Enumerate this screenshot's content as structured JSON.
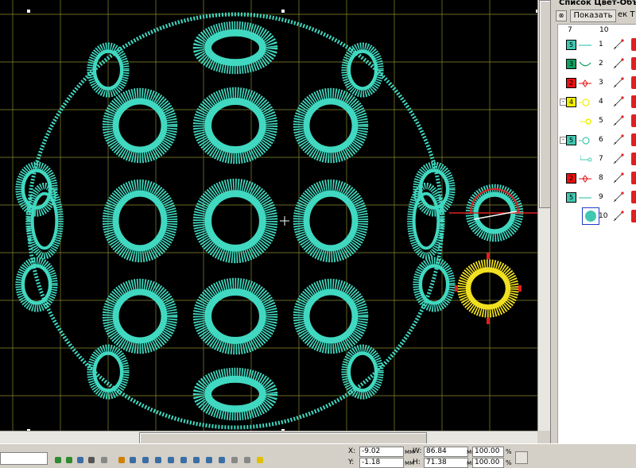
{
  "panel": {
    "title": "Список Цвет-Объект",
    "show_button": "Показать",
    "right_text": "ек Т",
    "col_headers": [
      "7",
      "10"
    ],
    "rows": [
      {
        "num": "1",
        "swatch_label": "5",
        "color": "#40c8b0",
        "type": "line"
      },
      {
        "num": "2",
        "swatch_label": "3",
        "color": "#10a060",
        "type": "curve"
      },
      {
        "num": "3",
        "swatch_label": "2",
        "color": "#e81010",
        "type": "diamond"
      },
      {
        "num": "4",
        "swatch_label": "4",
        "color": "#f0f000",
        "type": "circle",
        "expand": "-"
      },
      {
        "num": "5",
        "swatch_label": "",
        "color": "#f0f000",
        "type": "dot"
      },
      {
        "num": "6",
        "swatch_label": "5",
        "color": "#40c8b0",
        "type": "circle",
        "expand": "-"
      },
      {
        "num": "7",
        "swatch_label": "",
        "color": "#40c8b0",
        "type": "corner"
      },
      {
        "num": "8",
        "swatch_label": "2",
        "color": "#e81010",
        "type": "diamond"
      },
      {
        "num": "9",
        "swatch_label": "5",
        "color": "#40c8b0",
        "type": "line"
      },
      {
        "num": "10",
        "swatch_label": "",
        "color": "#40c8b0",
        "type": "thumbnail"
      }
    ]
  },
  "status": {
    "x_label": "X:",
    "x_value": "-9.02",
    "x_unit": "мм",
    "y_label": "Y:",
    "y_value": "-1.18",
    "y_unit": "мм",
    "w_label": "W:",
    "w_value": "86.84",
    "w_unit": "мм",
    "h_label": "H:",
    "h_value": "71.38",
    "h_unit": "мм",
    "sx_value": "100.00",
    "sx_unit": "%",
    "sy_value": "100.00",
    "sy_unit": "%"
  },
  "colors": {
    "stitch": "#40d8c0",
    "yellow": "#f0e020",
    "red": "#e02020",
    "grid": "#8a8a30",
    "canvas": "#000000"
  }
}
